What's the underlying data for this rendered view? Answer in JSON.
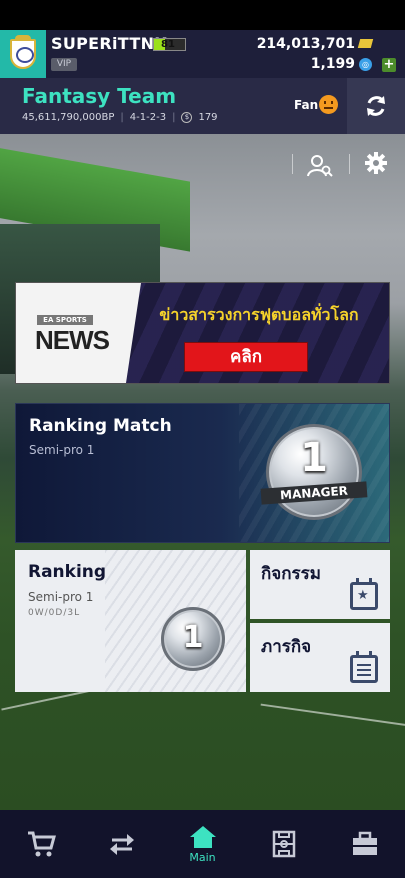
{
  "header": {
    "username": "SUPERiTTNK",
    "level": "81",
    "level_progress": 0.35,
    "vip_label": "VIP",
    "bp": "214,013,701",
    "fc": "1,199",
    "add_label": "+"
  },
  "team": {
    "name": "Fantasy Team",
    "value": "45,611,790,000BP",
    "formation": "4-1-2-3",
    "salary": "179",
    "salary_icon": "$",
    "fan_label": "Fan"
  },
  "news": {
    "brand_top": "EA SPORTS",
    "brand_big": "NEWS",
    "headline": "ข่าวสารวงการฟุตบอลทั่วโลก",
    "button_label": "คลิก"
  },
  "ranking_match": {
    "title": "Ranking Match",
    "subtitle": "Semi-pro 1",
    "emblem_number": "1",
    "emblem_ribbon": "MANAGER"
  },
  "ranking": {
    "title": "Ranking",
    "subtitle": "Semi-pro  1",
    "record": "0W/0D/3L",
    "emblem_number": "1"
  },
  "activities": {
    "title": "กิจกรรม",
    "icon": "calendar-star-icon"
  },
  "missions": {
    "title": "ภารกิจ",
    "icon": "calendar-list-icon"
  },
  "nav": [
    {
      "name": "shop",
      "label": "",
      "icon": "cart-icon"
    },
    {
      "name": "transfer",
      "label": "",
      "icon": "transfer-icon"
    },
    {
      "name": "main",
      "label": "Main",
      "icon": "home-icon"
    },
    {
      "name": "squad",
      "label": "",
      "icon": "pitch-icon"
    },
    {
      "name": "inventory",
      "label": "",
      "icon": "briefcase-icon"
    }
  ],
  "colors": {
    "accent": "#3de2c1",
    "header_bg": "#1e1f3a",
    "news_button": "#e2151a",
    "headline_yellow": "#f5d22b"
  }
}
